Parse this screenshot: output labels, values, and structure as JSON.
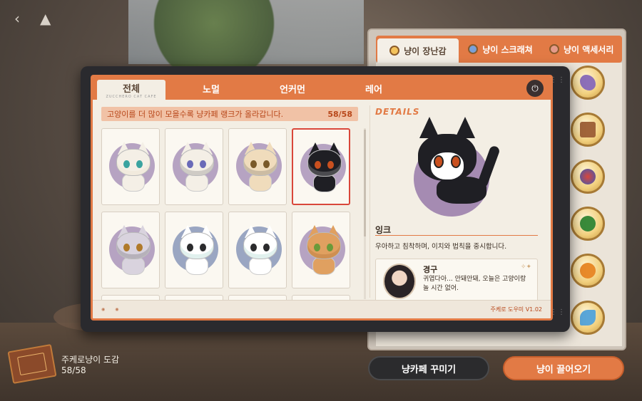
{
  "top_nav": {
    "back_icon": "chevron-left-icon",
    "home_icon": "triangle-logo-icon"
  },
  "right_panel": {
    "tabs": [
      {
        "label": "냥이 장난감",
        "icon": "yarn-icon"
      },
      {
        "label": "냥이 스크래쳐",
        "icon": "diamond-icon"
      },
      {
        "label": "냥이 액세서리",
        "icon": "accessory-icon"
      }
    ],
    "toys": [
      "dolphin-toy-icon",
      "gift-box-icon",
      "ball-icon",
      "watermelon-icon",
      "pumpkin-icon",
      "fish-toy-icon"
    ]
  },
  "device": {
    "tabs": [
      {
        "label": "전체",
        "sub": "ZUCCHERO CAT CAFE"
      },
      {
        "label": "노멀"
      },
      {
        "label": "언커먼"
      },
      {
        "label": "레어"
      }
    ],
    "rank_text": "고양이를 더 많이 모을수록 냥카페 랭크가 올라갑니다.",
    "rank_count": "58/58",
    "footer_version": "주케로 도우미 V1.02",
    "cards": [
      {
        "fur": "#f4efe6",
        "accent": "#e8d6b8",
        "eye": "#3aa3a0",
        "bg": "#b6a3c2"
      },
      {
        "fur": "#f4efe6",
        "accent": "#3b3b3f",
        "eye": "#6a6ab8",
        "bg": "#b6a3c2"
      },
      {
        "fur": "#f0dcbc",
        "accent": "#3b3b3f",
        "eye": "#7a5a2a",
        "bg": "#b6a3c2"
      },
      {
        "fur": "#1f1f24",
        "accent": "#ffffff",
        "eye": "#c9501f",
        "bg": "#b6a3c2",
        "selected": true
      },
      {
        "fur": "#d9d3de",
        "accent": "#2b2b2d",
        "eye": "#b07a2a",
        "bg": "#b6a3c2"
      },
      {
        "fur": "#ffffff",
        "accent": "#6ab8a8",
        "eye": "#2b2b2d",
        "bg": "#9aa6c2"
      },
      {
        "fur": "#ffffff",
        "accent": "#6ab8a8",
        "eye": "#2b2b2d",
        "bg": "#9aa6c2"
      },
      {
        "fur": "#e0a060",
        "accent": "#8a4a1a",
        "eye": "#6a9a3a",
        "bg": "#b6a3c2"
      }
    ],
    "details": {
      "logo": "DETAILS",
      "name": "잉크",
      "description": "우아하고 침착하며, 이치와 법칙을 중시합니다.",
      "quote": {
        "speaker": "경구",
        "text": "귀엽다아... 안돼안돼, 오늘은 고양이랑 놀 시간 없어."
      }
    }
  },
  "dex": {
    "title": "주케로냥이 도감",
    "count": "58/58"
  },
  "buttons": {
    "decorate": "냥카페 꾸미기",
    "lure": "냥이 끌어오기"
  },
  "colors": {
    "accent": "#e27a45",
    "selected_border": "#d9473a",
    "panel_bg": "#f3eee4"
  }
}
